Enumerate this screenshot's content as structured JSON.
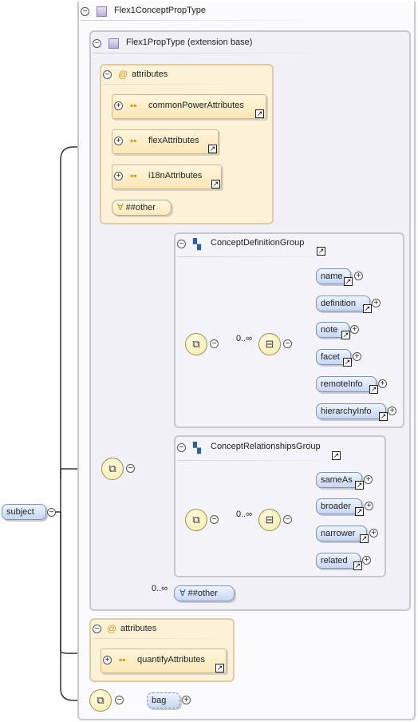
{
  "root": {
    "label": "subject"
  },
  "complex_type": {
    "label": "Flex1ConceptPropType"
  },
  "extension": {
    "label": "Flex1PropType (extension base)"
  },
  "attributes_block_1": {
    "title": "attributes",
    "items": [
      "commonPowerAttributes",
      "flexAttributes",
      "i18nAttributes"
    ],
    "other": "##other"
  },
  "group_1": {
    "label": "ConceptDefinitionGroup",
    "cardinality": "0..∞",
    "elements": [
      "name",
      "definition",
      "note",
      "facet",
      "remoteInfo",
      "hierarchyInfo"
    ]
  },
  "group_2": {
    "label": "ConceptRelationshipsGroup",
    "cardinality": "0..∞",
    "elements": [
      "sameAs",
      "broader",
      "narrower",
      "related"
    ]
  },
  "any_other": {
    "cardinality": "0..∞",
    "label": "##other"
  },
  "attributes_block_2": {
    "title": "attributes",
    "items": [
      "quantifyAttributes"
    ]
  },
  "bag": {
    "label": "bag"
  },
  "icons": {
    "expand": "plus-circle-icon",
    "collapse": "minus-circle-icon",
    "link": "link-arrow-icon",
    "sequence": "sequence-compositor-icon",
    "complex_type": "complex-type-icon",
    "group": "group-icon",
    "attribute_group": "attribute-group-icon",
    "attribute": "at-icon",
    "wildcard": "wildcard-icon"
  },
  "colors": {
    "element_fill": "#c7d6f2",
    "attribute_fill": "#fdf1d7",
    "border": "#c8c8cf"
  }
}
